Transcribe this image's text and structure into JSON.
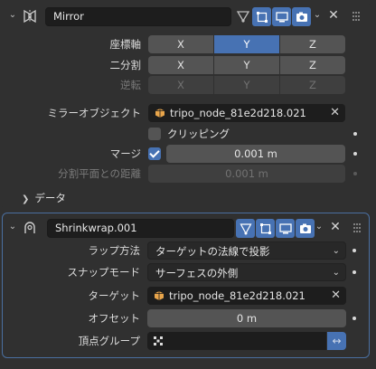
{
  "mirror": {
    "name": "Mirror",
    "axis_label": "座標軸",
    "bisect_label": "二分割",
    "flip_label": "逆転",
    "axes": [
      "X",
      "Y",
      "Z"
    ],
    "axis_active": "Y",
    "mirror_object_label": "ミラーオブジェクト",
    "mirror_object_value": "tripo_node_81e2d218.021",
    "clipping_label": "クリッピング",
    "clipping_checked": false,
    "merge_label": "マージ",
    "merge_checked": true,
    "merge_value": "0.001 m",
    "bisect_distance_label": "分割平面との距離",
    "bisect_distance_value": "0.001 m",
    "data_subpanel": "データ"
  },
  "shrinkwrap": {
    "name": "Shrinkwrap.001",
    "wrap_method_label": "ラップ方法",
    "wrap_method_value": "ターゲットの法線で投影",
    "snap_mode_label": "スナップモード",
    "snap_mode_value": "サーフェスの外側",
    "target_label": "ターゲット",
    "target_value": "tripo_node_81e2d218.021",
    "offset_label": "オフセット",
    "offset_value": "0 m",
    "vertex_group_label": "頂点グループ",
    "vertex_group_value": ""
  },
  "colors": {
    "accent": "#4772b3",
    "background": "#303030",
    "field": "#1d1d1d",
    "button": "#545454"
  },
  "icons": {
    "mirror_modifier": "mirror-modifier-icon",
    "shrinkwrap_modifier": "shrinkwrap-modifier-icon",
    "edit_cage": "edit-cage-icon",
    "edit_mode": "edit-mode-icon",
    "viewport": "monitor-icon",
    "render": "camera-icon",
    "close": "close-icon",
    "object": "mesh-object-icon",
    "swap": "swap-arrows-icon",
    "vertex_group": "vertex-group-icon"
  }
}
